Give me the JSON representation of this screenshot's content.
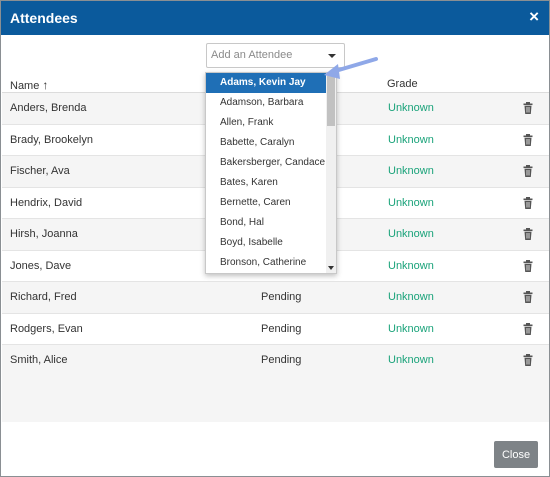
{
  "modal": {
    "title": "Attendees",
    "close_symbol": "×",
    "add_attendee_placeholder": "Add an Attendee",
    "columns": {
      "name": "Name",
      "sort_arrow": "↑",
      "grade": "Grade"
    },
    "rows": [
      {
        "name": "Anders, Brenda",
        "status": "",
        "grade": "Unknown"
      },
      {
        "name": "Brady, Brookelyn",
        "status": "",
        "grade": "Unknown"
      },
      {
        "name": "Fischer, Ava",
        "status": "",
        "grade": "Unknown"
      },
      {
        "name": "Hendrix, David",
        "status": "",
        "grade": "Unknown"
      },
      {
        "name": "Hirsh, Joanna",
        "status": "",
        "grade": "Unknown"
      },
      {
        "name": "Jones, Dave",
        "status": "",
        "grade": "Unknown"
      },
      {
        "name": "Richard, Fred",
        "status": "Pending",
        "grade": "Unknown"
      },
      {
        "name": "Rodgers, Evan",
        "status": "Pending",
        "grade": "Unknown"
      },
      {
        "name": "Smith, Alice",
        "status": "Pending",
        "grade": "Unknown"
      }
    ],
    "close_button": "Close"
  },
  "dropdown": {
    "items": [
      "Adams, Kevin Jay",
      "Adamson, Barbara",
      "Allen, Frank",
      "Babette, Caralyn",
      "Bakersberger, Candace",
      "Bates, Karen",
      "Bernette, Caren",
      "Bond, Hal",
      "Boyd, Isabelle",
      "Bronson, Catherine"
    ],
    "highlighted_index": 0
  },
  "colors": {
    "header": "#0b5a9c",
    "grade_text": "#1aa37a",
    "highlight": "#1f6fb6",
    "pointer_arrow": "#8fa8e8"
  },
  "icons": {
    "row_action": "trash-icon"
  }
}
